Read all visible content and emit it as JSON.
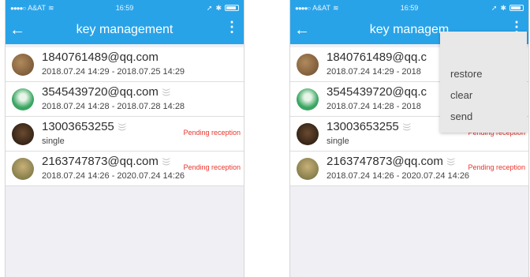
{
  "status": {
    "carrier": "A&AT",
    "time": "16:59"
  },
  "appbar": {
    "title": "key management",
    "more": "⋮",
    "back": "←"
  },
  "keys": [
    {
      "account": "1840761489@qq.com",
      "validity": "2018.07.24 14:29 - 2018.07.25 14:29",
      "status": "",
      "shared": false,
      "avatar_color": "#7a5a3c"
    },
    {
      "account": "3545439720@qq.com",
      "validity": "2018.07.24 14:28 - 2018.07.28 14:28",
      "status": "",
      "shared": true,
      "avatar_color": "#3aa561"
    },
    {
      "account": "13003653255",
      "validity": "single",
      "status": "Pending reception",
      "shared": true,
      "avatar_color": "#3a2a1e"
    },
    {
      "account": "2163747873@qq.com",
      "validity": "2018.07.24 14:26 - 2020.07.24 14:26",
      "status": "Pending reception",
      "shared": true,
      "avatar_color": "#8a7a4a"
    }
  ],
  "right_keys": [
    {
      "account": "1840761489@qq.c",
      "validity": "2018.07.24 14:29 - 2018",
      "status": ""
    },
    {
      "account": "3545439720@qq.c",
      "validity": "2018.07.24 14:28 - 2018",
      "status": ""
    },
    {
      "account": "13003653255",
      "validity": "single",
      "status": "Pending reception"
    },
    {
      "account": "2163747873@qq.com",
      "validity": "2018.07.24 14:26 - 2020.07.24 14:26",
      "status": "Pending reception"
    }
  ],
  "right_appbar": {
    "title": "key managem"
  },
  "menu": {
    "items": [
      "restore",
      "clear",
      "send"
    ]
  },
  "colors": {
    "accent": "#29a3e8",
    "pending": "#e8352d",
    "background": "#efeff4"
  }
}
